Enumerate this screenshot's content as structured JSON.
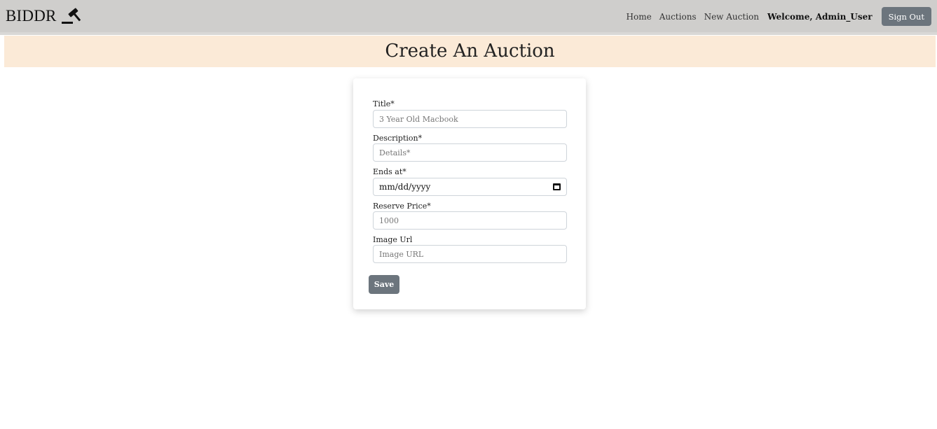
{
  "brand": {
    "name": "BIDDR"
  },
  "nav": {
    "links": [
      "Home",
      "Auctions",
      "New Auction"
    ],
    "welcome": "Welcome, Admin_User",
    "sign_out": "Sign Out"
  },
  "page": {
    "title": "Create An Auction"
  },
  "form": {
    "title": {
      "label": "Title*",
      "placeholder": "3 Year Old Macbook"
    },
    "description": {
      "label": "Description*",
      "placeholder": "Details*"
    },
    "ends_at": {
      "label": "Ends at*",
      "value": "mm/dd/yyyy"
    },
    "reserve_price": {
      "label": "Reserve Price*",
      "placeholder": "1000"
    },
    "image_url": {
      "label": "Image Url",
      "placeholder": "Image URL"
    },
    "save_label": "Save"
  },
  "icons": {
    "brand": "gavel-icon",
    "date": "calendar-icon"
  },
  "colors": {
    "navbar": "#cfcecc",
    "banner": "#fbead7",
    "button": "#6c757d"
  }
}
